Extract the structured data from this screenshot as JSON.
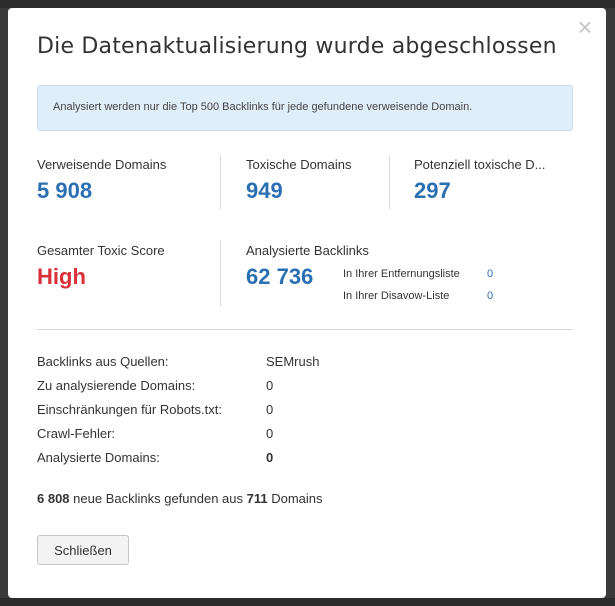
{
  "dialog": {
    "title": "Die Datenaktualisierung wurde abgeschlossen",
    "close_icon": "×",
    "info_text": "Analysiert werden nur die Top 500 Backlinks für jede gefundene verweisende Domain."
  },
  "metrics": {
    "referring_domains": {
      "label": "Verweisende Domains",
      "value": "5 908"
    },
    "toxic_domains": {
      "label": "Toxische Domains",
      "value": "949"
    },
    "potentially_toxic": {
      "label": "Potenziell toxische D...",
      "value": "297"
    },
    "toxic_score": {
      "label": "Gesamter Toxic Score",
      "value": "High"
    },
    "analyzed_backlinks": {
      "label": "Analysierte Backlinks",
      "value": "62 736"
    }
  },
  "sub_stats": [
    {
      "label": "In Ihrer Entfernungsliste",
      "value": "0"
    },
    {
      "label": "In Ihrer Disavow-Liste",
      "value": "0"
    }
  ],
  "details": [
    {
      "label": "Backlinks aus Quellen:",
      "value": "SEMrush"
    },
    {
      "label": "Zu analysierende Domains:",
      "value": "0"
    },
    {
      "label": "Einschränkungen für Robots.txt:",
      "value": "0"
    },
    {
      "label": "Crawl-Fehler:",
      "value": "0"
    },
    {
      "label": "Analysierte Domains:",
      "value": "0"
    }
  ],
  "summary": {
    "new_backlinks": "6 808",
    "text_middle": " neue Backlinks gefunden aus ",
    "domains": "711",
    "text_end": " Domains"
  },
  "buttons": {
    "close_label": "Schließen"
  },
  "colors": {
    "accent": "#2b6fb3",
    "danger": "#d9303a",
    "info_bg": "#e0eef9"
  }
}
